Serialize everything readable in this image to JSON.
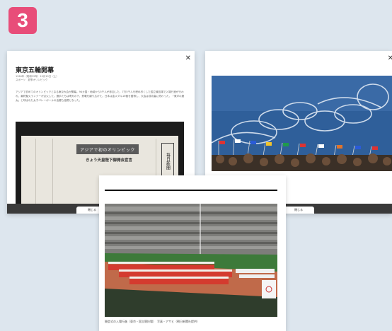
{
  "step_badge": "3",
  "article": {
    "close_icon": "close-icon",
    "title": "東京五輪開幕",
    "meta_line1": "1964年（昭和39年）10月10日（土）",
    "meta_line2": "スポーツ　夏季オリンピック",
    "body": "アジアで初めてのオリンピックとなる東京大会が開幕。94カ国・地域から5千人が参加した。7万5千人を埋め尽くした国立競技場で入場行進が行われ、最終聖火ランナーが点火した。選手たちは晴天の下、熱戦を繰り広げた。日本は金メダル16個を獲得し、大会は成功裏に終わった。「東洋の魔女」と呼ばれた女子バレーボールの活躍も話題となった。",
    "clipping": {
      "headline": "アジアで初のオリンピック",
      "subheadline": "きょう天皇陛下御開会宣言",
      "masthead": "毎日新聞"
    },
    "close_label": "閉じる"
  },
  "photo_panel": {
    "close_icon": "close-icon",
    "close_label": "閉じる"
  },
  "stadium_panel": {
    "caption": "開会式の入場行進（東京・国立競技場）　写真・アサヒ（朝日新聞社提供）"
  },
  "colors": {
    "badge": "#e84d79",
    "background": "#dde6ee",
    "track": "#c06a4a",
    "field": "#3d7a3a",
    "sky": "#2f5f9a"
  }
}
